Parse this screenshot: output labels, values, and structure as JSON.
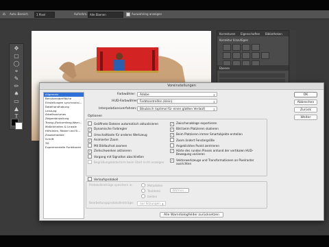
{
  "optbar": {
    "preset": "Auto.-Bereich",
    "size": "1 Pixel",
    "size_label": "Aufnehm.:",
    "layers": "Alle Ebenen",
    "sample": "Auswahlring anzeigen"
  },
  "panel": {
    "tabs": [
      "Korrekturen",
      "Eigenschaften",
      "Bibliotheken"
    ],
    "add_label": "Korrektur hinzufügen",
    "layers_title": "Ebenen"
  },
  "dialog": {
    "title": "Voreinstellungen",
    "nav": [
      "Allgemein",
      "Benutzeroberfläche",
      "Einstellungen synchronisi…",
      "Dateihandhabung",
      "Leistung",
      "Arbeitsvolumes",
      "Zeigerdarstellung",
      "Transp./Farbumfang-Warn…",
      "Maßeinheiten & Lineale",
      "Hilfslinien, Raster und Sl…",
      "Zusatzmodule",
      "Schrift",
      "3D",
      "Experimentelle Funktionen"
    ],
    "color_picker_label": "Farbwähler:",
    "color_picker_value": "Adobe",
    "hud_label": "HUD-Farbwähler:",
    "hud_value": "Farbtonstreifen (klein)",
    "interp_label": "Interpolationsverfahren:",
    "interp_value": "Bikubisch (optimal für einen glatten Verlauf)",
    "options_title": "Optionen",
    "options_left": [
      {
        "label": "Geöffnete Dateien automatisch aktualisieren",
        "checked": false,
        "disabled": false
      },
      {
        "label": "Dynamische Farbregler",
        "checked": true,
        "disabled": false
      },
      {
        "label": "Umschalttaste für anderes Werkzeug",
        "checked": false,
        "disabled": false
      },
      {
        "label": "Animierter Zoom",
        "checked": true,
        "disabled": false
      },
      {
        "label": "Mit Bildlaufrad zoomen",
        "checked": false,
        "disabled": false
      },
      {
        "label": "Ziehschwenken aktivieren",
        "checked": true,
        "disabled": false
      },
      {
        "label": "Vorgang mit Signalton abschließen",
        "checked": false,
        "disabled": false
      },
      {
        "label": "Begrüßungsbildschirm beim Start nicht anzeigen",
        "checked": false,
        "disabled": true
      }
    ],
    "options_right": [
      {
        "label": "Zwischenablage exportieren",
        "checked": true
      },
      {
        "label": "Bild beim Platzieren skalieren",
        "checked": true
      },
      {
        "label": "Beim Platzieren immer Smartobjekte erstellen",
        "checked": true
      },
      {
        "label": "Zoom ändert Fenstergröße",
        "checked": false
      },
      {
        "label": "Angeklickten Punkt zentrieren",
        "checked": false
      },
      {
        "label": "Härte des runden Pinsels anhand der vertikalen HUD-Bewegung variieren",
        "checked": true
      },
      {
        "label": "Vektorwerkzeuge und Transformationen an Pixelraster ausrichten",
        "checked": true
      }
    ],
    "history_title": "Verlaufsprotokoll",
    "history_save_label": "Protokolleinträge speichern in:",
    "history_radios": [
      "Metadaten",
      "Textdatei",
      "beiden"
    ],
    "choose_label": "Wählen...",
    "history_edit_label": "Bearbeitungsprotokolleinträge:",
    "history_edit_value": "nur Sitzungen",
    "reset_label": "Alle Warndialogfelder zurücksetzen",
    "buttons": [
      "OK",
      "Abbrechen",
      "Zurück",
      "Weiter"
    ]
  }
}
